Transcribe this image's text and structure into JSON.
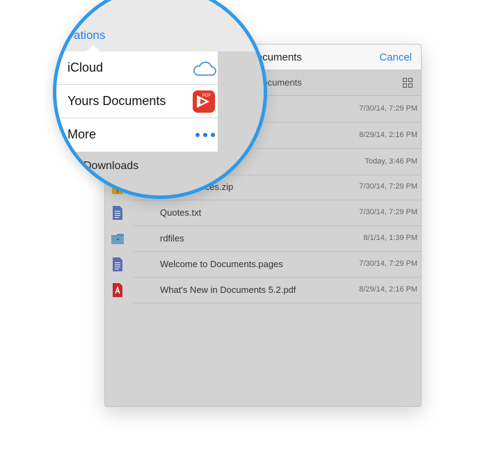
{
  "header": {
    "title": "Yours Documents",
    "cancel_label": "Cancel"
  },
  "subbar": {
    "path": "Documents"
  },
  "files": [
    {
      "name": "",
      "date": "7/30/14, 7:29 PM"
    },
    {
      "name": "",
      "date": "8/29/14, 2:16 PM"
    },
    {
      "name": "",
      "date": "Today, 3:46 PM"
    },
    {
      "name": "World Sources.zip",
      "date": "7/30/14, 7:29 PM"
    },
    {
      "name": "Quotes.txt",
      "date": "7/30/14, 7:29 PM"
    },
    {
      "name": "rdfiles",
      "date": "8/1/14, 1:39 PM"
    },
    {
      "name": "Welcome to Documents.pages",
      "date": "7/30/14, 7:29 PM"
    },
    {
      "name": "What's New in Documents 5.2.pdf",
      "date": "8/29/14, 2:16 PM"
    }
  ],
  "lens": {
    "back_label": "ations",
    "locations": [
      {
        "label": "iCloud",
        "icon": "cloud-icon"
      },
      {
        "label": "Yours Documents",
        "icon": "pdf-expert-icon"
      },
      {
        "label": "More",
        "icon": "more-icon"
      }
    ],
    "downloads_label": "Downloads"
  },
  "colors": {
    "accent": "#2b7de2",
    "lens_border": "#2f9ae8",
    "panel_bg": "#d3d3d3"
  }
}
